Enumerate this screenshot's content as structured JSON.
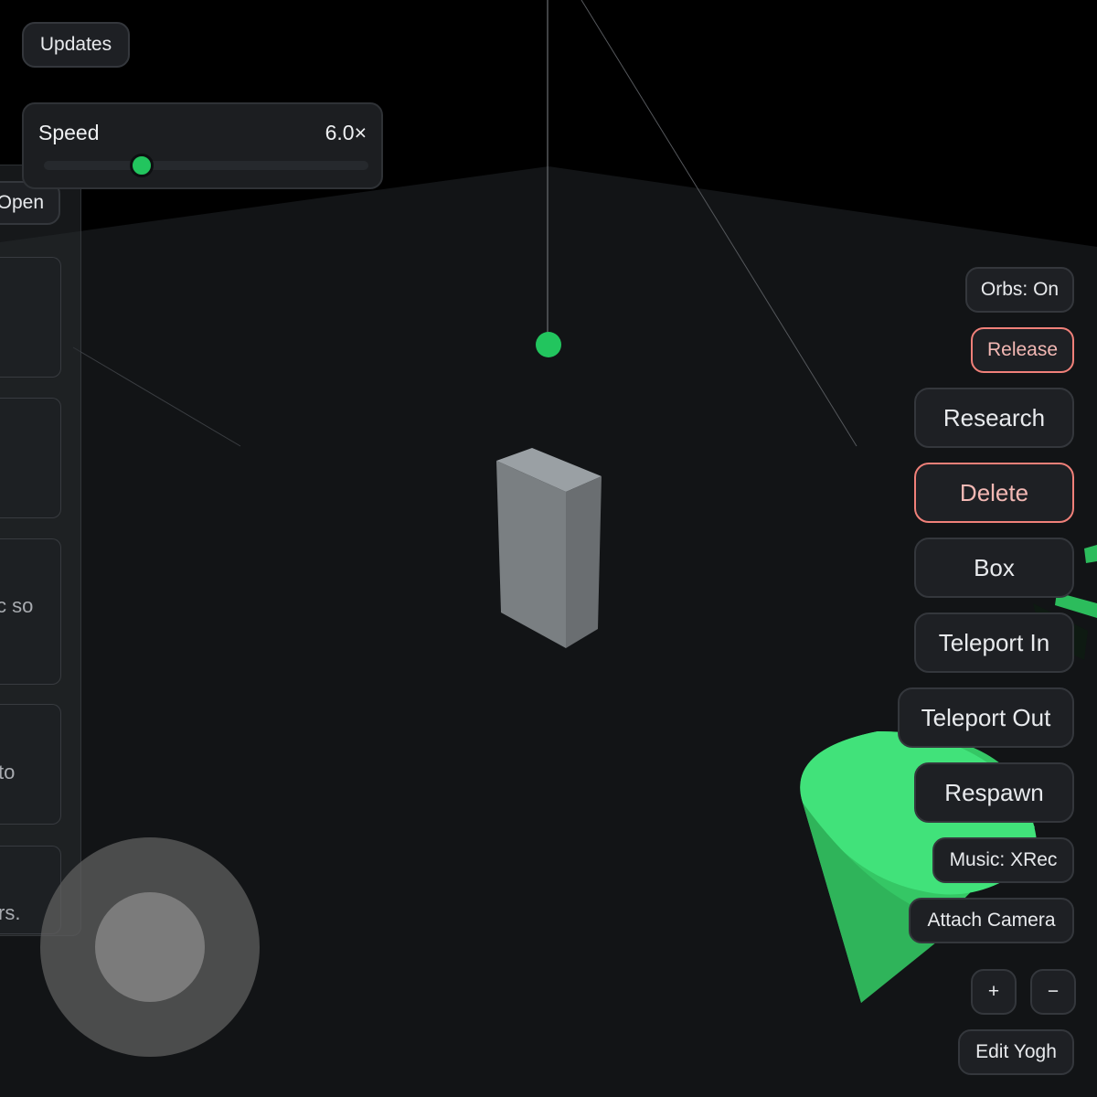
{
  "updates_label": "Updates",
  "speed": {
    "label": "Speed",
    "value_text": "6.0×",
    "level": 0.3
  },
  "side_panel": {
    "open_label": "Open",
    "card_texts": [
      "c so",
      "to",
      "rs."
    ]
  },
  "right_buttons": {
    "orbs": "Orbs: On",
    "release": "Release",
    "research": "Research",
    "delete": "Delete",
    "box": "Box",
    "teleport_in": "Teleport In",
    "teleport_out": "Teleport Out",
    "respawn": "Respawn",
    "music": "Music: XRec",
    "attach_camera": "Attach Camera",
    "zoom_in": "+",
    "zoom_out": "−",
    "edit": "Edit Yogh"
  },
  "colors": {
    "accent": "#22c55e",
    "danger": "#f08079",
    "floor": "#121416",
    "cone": "#3ddc74"
  }
}
